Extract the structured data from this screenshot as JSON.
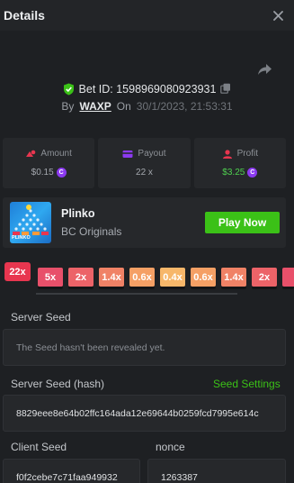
{
  "header": {
    "title": "Details"
  },
  "bet": {
    "id_label": "Bet ID: 1598969080923931",
    "by_label": "By",
    "user": "WAXP",
    "on_label": "On",
    "date": "30/1/2023, 21:53:31"
  },
  "stats": {
    "amount": {
      "label": "Amount",
      "value": "$0.15"
    },
    "payout": {
      "label": "Payout",
      "value": "22 x"
    },
    "profit": {
      "label": "Profit",
      "value": "$3.25"
    }
  },
  "game": {
    "name": "Plinko",
    "provider": "BC Originals",
    "thumb_label": "PLINKO",
    "play_label": "Play Now"
  },
  "multipliers": {
    "hit": "22x",
    "values": [
      "5x",
      "2x",
      "1.4x",
      "0.6x",
      "0.4x",
      "0.6x",
      "1.4x",
      "2x"
    ]
  },
  "seeds": {
    "server_seed_label": "Server Seed",
    "server_seed_value": "The Seed hasn't been revealed yet.",
    "server_hash_label": "Server Seed (hash)",
    "seed_settings_label": "Seed Settings",
    "server_hash_value": "8829eee8e64b02ffc164ada12e69644b0259fcd7995e614c",
    "client_seed_label": "Client Seed",
    "client_seed_value": "f0f2cebe7c71faa949932",
    "nonce_label": "nonce",
    "nonce_value": "1263387"
  },
  "colors": {
    "accent_green": "#3bc117",
    "coin_purple": "#8c3af0",
    "hit_red": "#e8364f"
  }
}
